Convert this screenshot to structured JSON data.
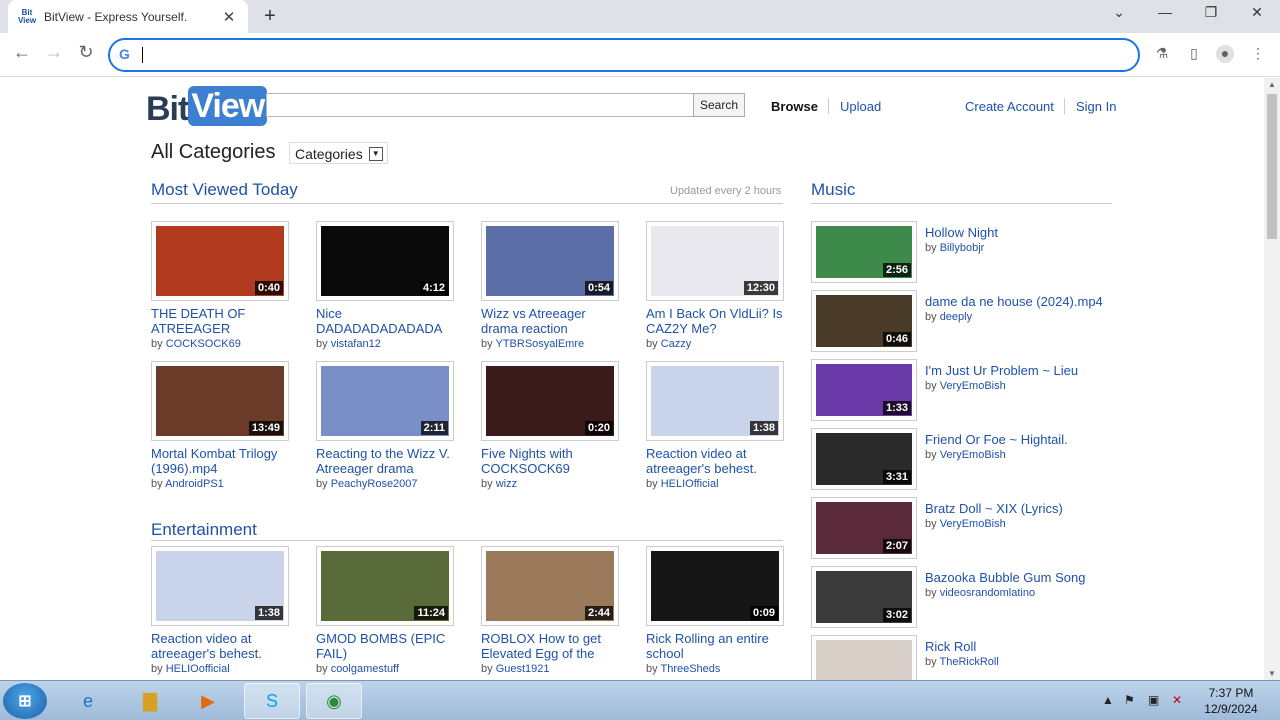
{
  "browser": {
    "tab_title": "BitView - Express Yourself.",
    "tab_favicon_text_top": "Bit",
    "tab_favicon_text_bottom": "View",
    "address_value": "",
    "g_icon": "G"
  },
  "site": {
    "logo_bit": "Bit",
    "logo_view": "View",
    "search_placeholder": "",
    "search_button": "Search",
    "nav_browse": "Browse",
    "nav_upload": "Upload",
    "nav_create_account": "Create Account",
    "nav_sign_in": "Sign In",
    "all_categories": "All Categories",
    "categories_button": "Categories"
  },
  "most_viewed": {
    "heading": "Most Viewed Today",
    "updated": "Updated every 2 hours",
    "videos": [
      {
        "title": "THE DEATH OF ATREEAGER",
        "by": "by",
        "author": "COCKSOCK69",
        "duration": "0:40",
        "color": "#b23a1e"
      },
      {
        "title": "Nice DADADADADADADA",
        "by": "by",
        "author": "vistafan12",
        "duration": "4:12",
        "color": "#0a0a0a"
      },
      {
        "title": "Wizz vs Atreeager drama reaction",
        "by": "by",
        "author": "YTBRSosyalEmre",
        "duration": "0:54",
        "color": "#5b6ea8"
      },
      {
        "title": "Am I Back On VldLii? Is CAZ2Y Me?",
        "by": "by",
        "author": "Cazzy",
        "duration": "12:30",
        "color": "#e8e8ee"
      },
      {
        "title": "Mortal Kombat Trilogy (1996).mp4",
        "by": "by",
        "author": "AndroidPS1",
        "duration": "13:49",
        "color": "#6b3b2a"
      },
      {
        "title": "Reacting to the Wizz V. Atreeager drama",
        "by": "by",
        "author": "PeachyRose2007",
        "duration": "2:11",
        "color": "#7a8fc8"
      },
      {
        "title": "Five Nights with COCKSOCK69",
        "by": "by",
        "author": "wizz",
        "duration": "0:20",
        "color": "#3a1a1a"
      },
      {
        "title": "Reaction video at atreeager's behest.",
        "by": "by",
        "author": "HELIOfficial",
        "duration": "1:38",
        "color": "#c9d4ea"
      }
    ]
  },
  "entertainment": {
    "heading": "Entertainment",
    "videos": [
      {
        "title": "Reaction video at atreeager's behest.",
        "by": "by",
        "author": "HELIOofficial",
        "duration": "1:38",
        "color": "#c9d4ea"
      },
      {
        "title": "GMOD BOMBS (EPIC FAIL)",
        "by": "by",
        "author": "coolgamestuff",
        "duration": "11:24",
        "color": "#5a6b3a"
      },
      {
        "title": "ROBLOX How to get Elevated Egg of the",
        "by": "by",
        "author": "Guest1921",
        "duration": "2:44",
        "color": "#9a7a5a"
      },
      {
        "title": "Rick Rolling an entire school",
        "by": "by",
        "author": "ThreeSheds",
        "duration": "0:09",
        "color": "#151515"
      }
    ]
  },
  "music": {
    "heading": "Music",
    "items": [
      {
        "title": "Hollow Night",
        "by": "by",
        "author": "Billybobjr",
        "duration": "2:56",
        "color": "#3e8a4a"
      },
      {
        "title": "dame da ne house (2024).mp4",
        "by": "by",
        "author": "deeply",
        "duration": "0:46",
        "color": "#4a3a28"
      },
      {
        "title": "I'm Just Ur Problem ~ Lieu",
        "by": "by",
        "author": "VeryEmoBish",
        "duration": "1:33",
        "color": "#6a3aa8"
      },
      {
        "title": "Friend Or Foe ~ Hightail.",
        "by": "by",
        "author": "VeryEmoBish",
        "duration": "3:31",
        "color": "#2a2a2a"
      },
      {
        "title": "Bratz Doll ~ XIX (Lyrics)",
        "by": "by",
        "author": "VeryEmoBish",
        "duration": "2:07",
        "color": "#5a2a3a"
      },
      {
        "title": "Bazooka Bubble Gum Song",
        "by": "by",
        "author": "videosrandomlatino",
        "duration": "3:02",
        "color": "#3a3a3a"
      },
      {
        "title": "Rick Roll",
        "by": "by",
        "author": "TheRickRoll",
        "duration": "",
        "color": "#d8d0c8"
      }
    ]
  },
  "taskbar": {
    "time": "7:37 PM",
    "date": "12/9/2024"
  }
}
